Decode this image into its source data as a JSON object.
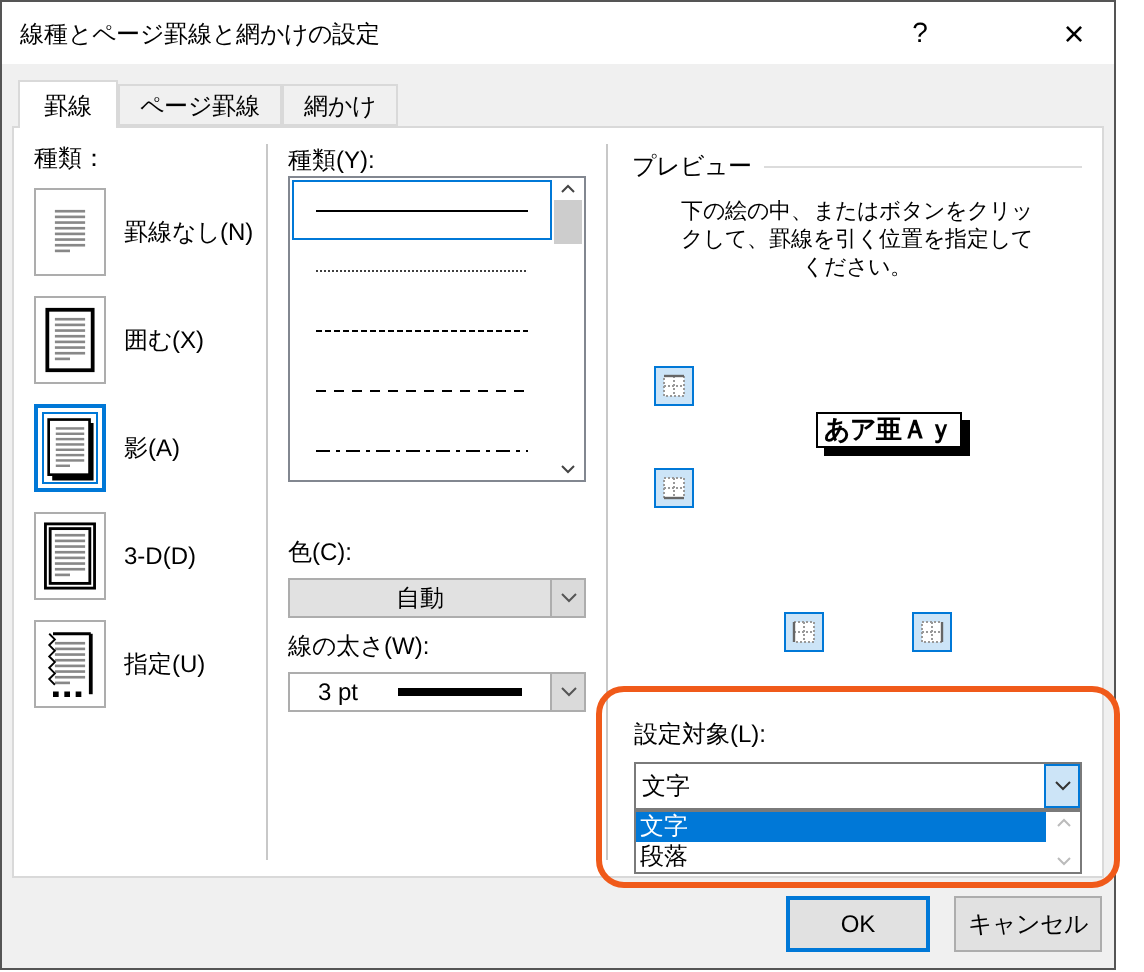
{
  "window": {
    "title": "線種とページ罫線と網かけの設定",
    "help": "?",
    "close": "×"
  },
  "tabs": [
    {
      "label": "罫線",
      "selected": true
    },
    {
      "label": "ページ罫線",
      "selected": false
    },
    {
      "label": "網かけ",
      "selected": false
    }
  ],
  "setting": {
    "label": "種類：",
    "items": [
      {
        "label": "罫線なし(N)",
        "kind": "none",
        "selected": false
      },
      {
        "label": "囲む(X)",
        "kind": "box",
        "selected": false
      },
      {
        "label": "影(A)",
        "kind": "shadow",
        "selected": true
      },
      {
        "label": "3-D(D)",
        "kind": "threed",
        "selected": false
      },
      {
        "label": "指定(U)",
        "kind": "custom",
        "selected": false
      }
    ]
  },
  "style": {
    "label": "種類(Y):",
    "items": [
      {
        "kind": "solid",
        "selected": true
      },
      {
        "kind": "dotted",
        "selected": false
      },
      {
        "kind": "dashed",
        "selected": false
      },
      {
        "kind": "longdash",
        "selected": false
      },
      {
        "kind": "dashdot",
        "selected": false
      }
    ]
  },
  "color": {
    "label": "色(C):",
    "value": "自動"
  },
  "width": {
    "label": "線の太さ(W):",
    "value": "3 pt"
  },
  "preview": {
    "title": "プレビュー",
    "instructions": "下の絵の中、またはボタンをクリックして、罫線を引く位置を指定してください。",
    "sample": "あア亜Ａｙ"
  },
  "apply_to": {
    "label": "設定対象(L):",
    "value": "文字",
    "highlighted": true,
    "options": [
      {
        "label": "文字",
        "selected": true
      },
      {
        "label": "段落",
        "selected": false
      }
    ]
  },
  "buttons": [
    {
      "label": "OK",
      "kind": "default"
    },
    {
      "label": "キャンセル",
      "kind": "normal"
    }
  ]
}
